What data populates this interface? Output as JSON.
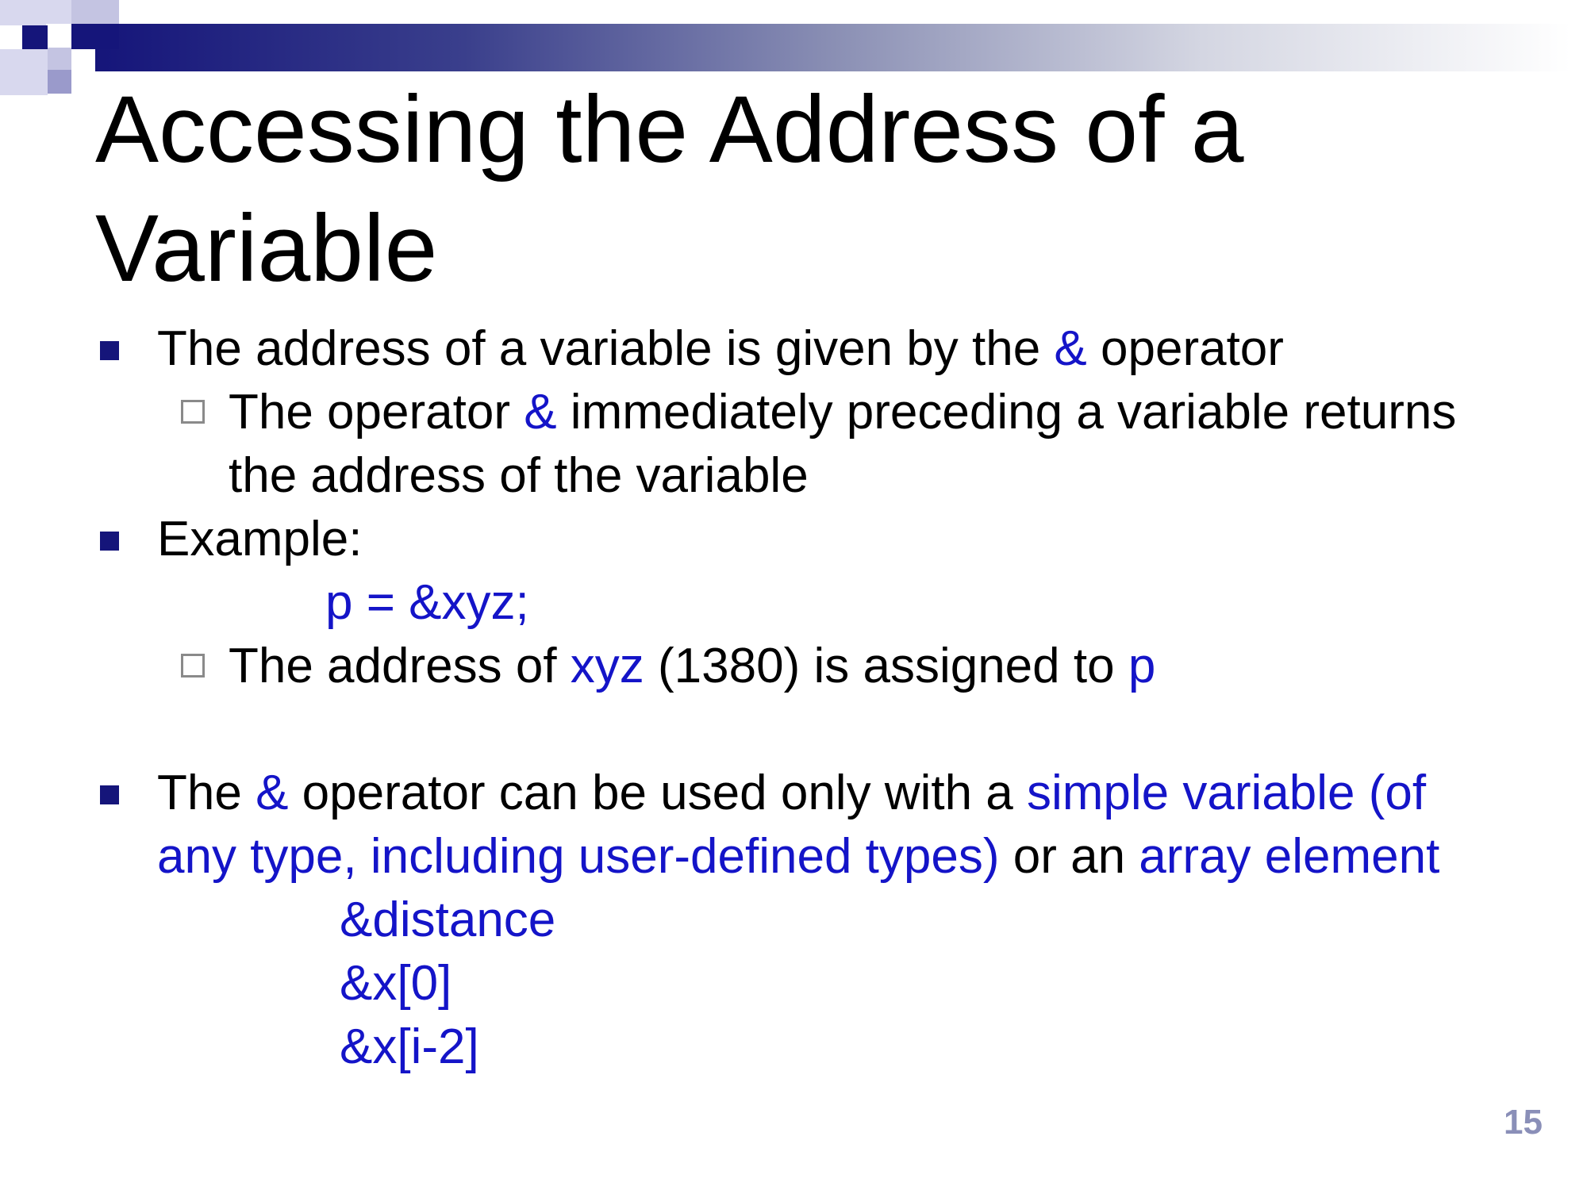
{
  "slide": {
    "title": "Accessing the Address of a Variable",
    "page_number": "15",
    "bullets": [
      {
        "parts": [
          "The address of a variable is given by the ",
          "&",
          " operator"
        ],
        "sub": {
          "parts": [
            "The operator ",
            "&",
            " immediately preceding a variable returns the address of the variable"
          ]
        }
      },
      {
        "label": "Example:",
        "code": "p = &xyz;",
        "sub": {
          "parts": [
            "The address of ",
            "xyz",
            " (1380) is assigned to ",
            "p"
          ]
        }
      },
      {
        "parts": [
          "The ",
          "&",
          " operator can be used only with a ",
          "simple variable (of any type, including user-defined types)",
          " or an ",
          "array element"
        ],
        "code_lines": [
          "&distance",
          "&x[0]",
          "&x[i-2]"
        ]
      }
    ]
  },
  "colors": {
    "header_dark": "#15157a",
    "code_blue": "#1414c8",
    "sub_bullet_gray": "#8a8a8a",
    "page_number": "#8a8fb8"
  }
}
